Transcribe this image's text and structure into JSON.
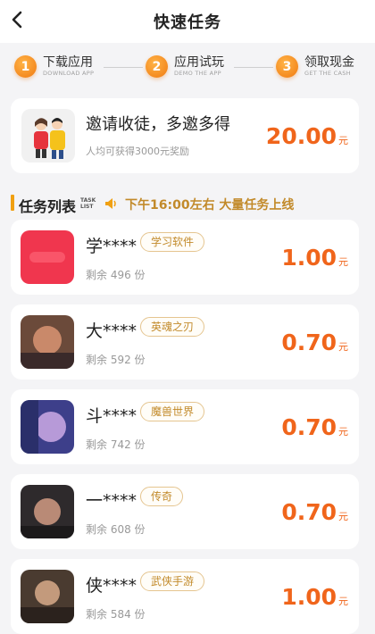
{
  "header": {
    "title": "快速任务"
  },
  "steps": [
    {
      "num": "1",
      "label": "下载应用",
      "sub": "DOWNLOAD APP"
    },
    {
      "num": "2",
      "label": "应用试玩",
      "sub": "DEMO THE APP"
    },
    {
      "num": "3",
      "label": "领取现金",
      "sub": "GET THE CASH"
    }
  ],
  "invite": {
    "headline": "邀请收徒，多邀多得",
    "subtext": "人均可获得3000元奖励",
    "amount": "20.00",
    "unit": "元"
  },
  "task_list": {
    "title": "任务列表",
    "title_en_1": "TASK",
    "title_en_2": "LIST",
    "notice": "下午16:00左右  大量任务上线",
    "tasks": [
      {
        "name": "学****",
        "tag": "学习软件",
        "remain": "剩余 496 份",
        "price": "1.00",
        "unit": "元"
      },
      {
        "name": "大****",
        "tag": "英魂之刃",
        "remain": "剩余 592 份",
        "price": "0.70",
        "unit": "元"
      },
      {
        "name": "斗****",
        "tag": "魔兽世界",
        "remain": "剩余 742 份",
        "price": "0.70",
        "unit": "元"
      },
      {
        "name": "一****",
        "tag": "传奇",
        "remain": "剩余 608 份",
        "price": "0.70",
        "unit": "元"
      },
      {
        "name": "侠****",
        "tag": "武侠手游",
        "remain": "剩余 584 份",
        "price": "1.00",
        "unit": "元"
      }
    ]
  },
  "colors": {
    "accent": "#f0651b",
    "step": "#f07a10",
    "tag": "#c28a2a"
  }
}
